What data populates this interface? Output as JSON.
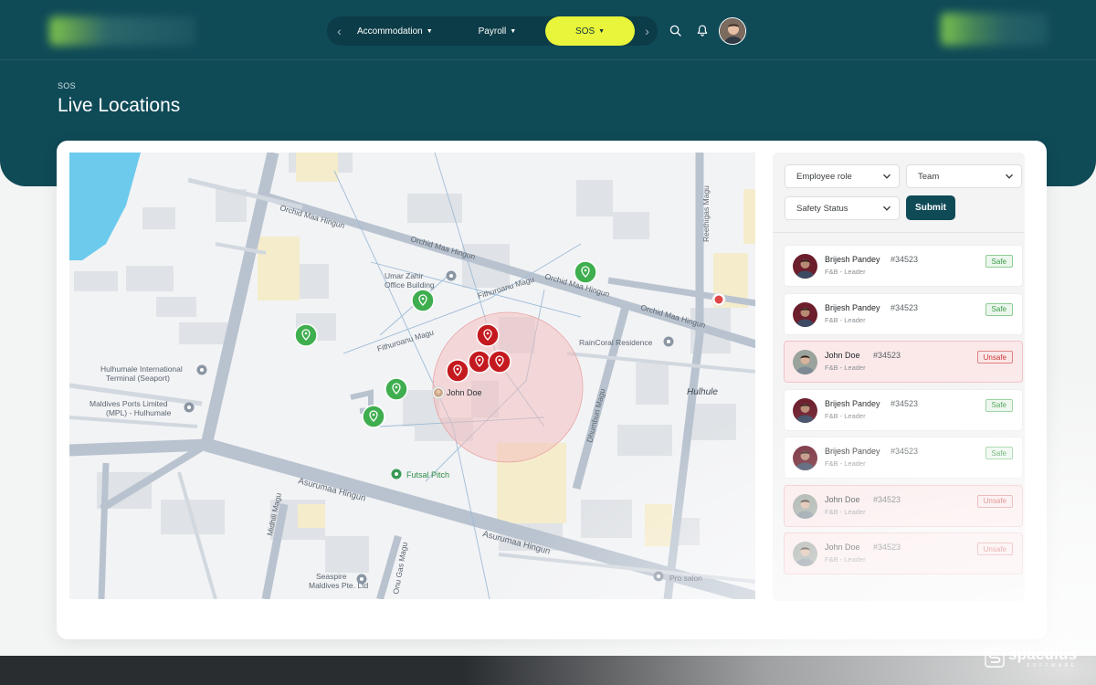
{
  "nav": {
    "items": [
      {
        "label": "Accommodation",
        "active": false
      },
      {
        "label": "Payroll",
        "active": false
      },
      {
        "label": "SOS",
        "active": true
      }
    ],
    "prev_icon": "chevron-left-icon",
    "next_icon": "chevron-right-icon",
    "search_icon": "search-icon",
    "notification_icon": "bell-icon"
  },
  "page": {
    "breadcrumb": "SOS",
    "title": "Live Locations"
  },
  "map": {
    "streets": [
      "Orchid Maa Hingun",
      "Orchid Maa Hingun",
      "Orchid Maa Hingun",
      "Fithuroanu Magu",
      "Fithuroanu Magu",
      "Asurumaa Hingun",
      "Asurumaa Hingun",
      "Dhumburi Magu",
      "Midhili Magu",
      "Onu Gas Magu",
      "Reethigas Magu"
    ],
    "places": [
      "Umar Zahir Office Building",
      "RainCoral Residence",
      "Hulhumale International Terminal (Seaport)",
      "Maldives Ports Limited (MPL) - Hulhumale",
      "Futsal Pitch",
      "Seaspire Maldives Pte. Ltd",
      "Pro salon",
      "Hulhule"
    ],
    "marker_label": "John Doe",
    "safe_markers": 6,
    "unsafe_markers": 4,
    "colors": {
      "safe": "#3fae4f",
      "unsafe": "#c41a1f",
      "alert_zone": "#f4bcbc"
    }
  },
  "filters": {
    "employee_role": "Employee role",
    "team": "Team",
    "safety_status": "Safety Status",
    "submit": "Submit"
  },
  "employees": [
    {
      "name": "Brijesh Pandey",
      "id": "#34523",
      "role": "F&B - Leader",
      "status": "Safe"
    },
    {
      "name": "Brijesh Pandey",
      "id": "#34523",
      "role": "F&B - Leader",
      "status": "Safe"
    },
    {
      "name": "John Doe",
      "id": "#34523",
      "role": "F&B - Leader",
      "status": "Unsafe"
    },
    {
      "name": "Brijesh Pandey",
      "id": "#34523",
      "role": "F&B - Leader",
      "status": "Safe"
    },
    {
      "name": "Brijesh Pandey",
      "id": "#34523",
      "role": "F&B - Leader",
      "status": "Safe"
    },
    {
      "name": "John Doe",
      "id": "#34523",
      "role": "F&B - Leader",
      "status": "Unsafe"
    },
    {
      "name": "John Doe",
      "id": "#34523",
      "role": "F&B - Leader",
      "status": "Unsafe"
    }
  ],
  "brand": {
    "name": "spaculus",
    "tagline": "SOFTWARE"
  },
  "theme": {
    "primary": "#0f4a57",
    "accent": "#e9f53a"
  }
}
